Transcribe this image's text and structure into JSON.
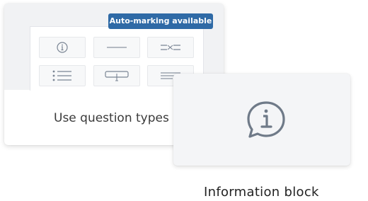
{
  "badge_text": "Auto-marking available",
  "card_caption": "Use question types",
  "info_caption": "Information block",
  "colors": {
    "badge_bg": "#2f6aa6",
    "icon_stroke": "#6f7a88"
  },
  "tiles": [
    {
      "icon": "info-circle-icon"
    },
    {
      "icon": "short-line-icon"
    },
    {
      "icon": "match-lines-icon"
    },
    {
      "icon": "list-icon"
    },
    {
      "icon": "text-input-icon"
    },
    {
      "icon": "paragraph-lines-icon"
    }
  ],
  "large_icon": "info-speech-bubble-icon"
}
